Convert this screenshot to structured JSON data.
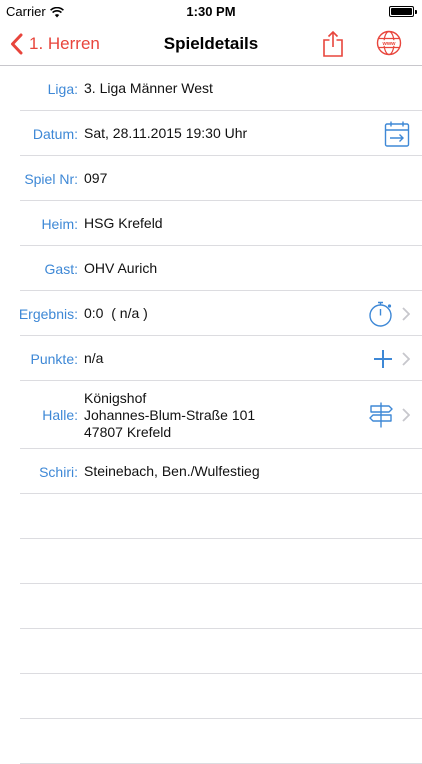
{
  "status_bar": {
    "carrier": "Carrier",
    "time": "1:30 PM"
  },
  "nav": {
    "back_label": "1. Herren",
    "title": "Spieldetails",
    "share_icon": "share-icon",
    "web_icon": "globe-www-icon",
    "accent_color": "#e8453c"
  },
  "details": {
    "label_color": "#3e88d6",
    "rows": [
      {
        "label": "Liga:",
        "value": "3. Liga Männer West"
      },
      {
        "label": "Datum:",
        "value": "Sat, 28.11.2015 19:30 Uhr",
        "icon": "calendar-add-icon"
      },
      {
        "label": "Spiel Nr:",
        "value": "097"
      },
      {
        "label": "Heim:",
        "value": "HSG Krefeld"
      },
      {
        "label": "Gast:",
        "value": "OHV Aurich"
      },
      {
        "label": "Ergebnis:",
        "value": "0:0  ( n/a )",
        "icon": "stopwatch-icon"
      },
      {
        "label": "Punkte:",
        "value": "n/a",
        "icon": "plus-icon"
      },
      {
        "label": "Halle:",
        "value_lines": [
          "Königshof",
          "Johannes-Blum-Straße 101",
          "47807 Krefeld"
        ],
        "icon": "signpost-icon"
      },
      {
        "label": "Schiri:",
        "value": "Steinebach, Ben./Wulfestieg"
      }
    ]
  }
}
